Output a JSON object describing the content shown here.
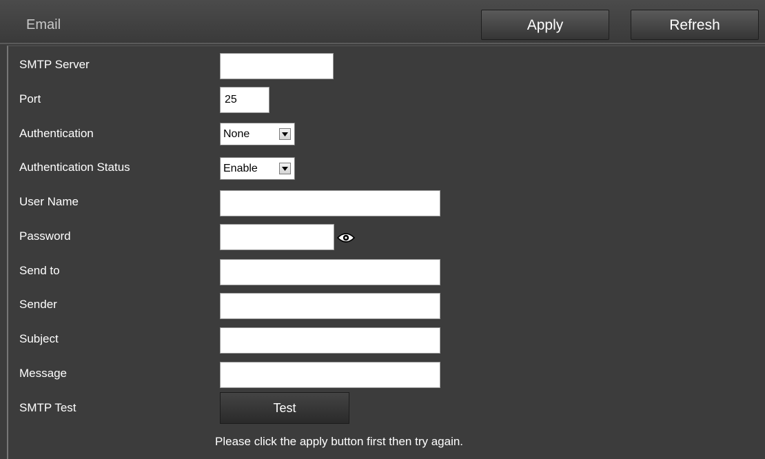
{
  "header": {
    "title": "Email",
    "apply_label": "Apply",
    "refresh_label": "Refresh"
  },
  "form": {
    "smtp_server": {
      "label": "SMTP Server",
      "value": ""
    },
    "port": {
      "label": "Port",
      "value": "25"
    },
    "authentication": {
      "label": "Authentication",
      "value": "None"
    },
    "authentication_status": {
      "label": "Authentication Status",
      "value": "Enable"
    },
    "user_name": {
      "label": "User Name",
      "value": ""
    },
    "password": {
      "label": "Password",
      "value": ""
    },
    "send_to": {
      "label": "Send to",
      "value": ""
    },
    "sender": {
      "label": "Sender",
      "value": ""
    },
    "subject": {
      "label": "Subject",
      "value": ""
    },
    "message": {
      "label": "Message",
      "value": ""
    },
    "smtp_test": {
      "label": "SMTP Test",
      "button_label": "Test"
    }
  },
  "hint": "Please click the apply button first then try again.",
  "icons": {
    "password_toggle": "eye-icon",
    "dropdown": "chevron-down-icon"
  }
}
